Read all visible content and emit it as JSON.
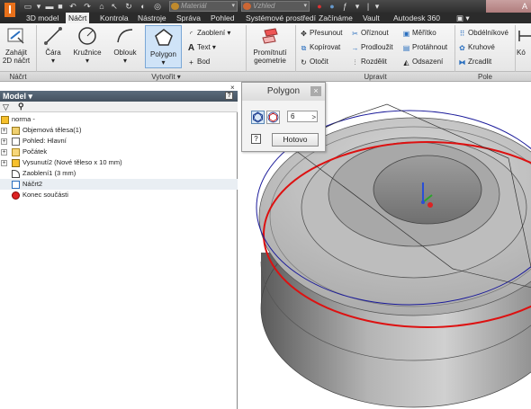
{
  "quick_access": {
    "material_placeholder": "Materiál",
    "appearance_placeholder": "Vzhled",
    "title_right": "A",
    "icons": [
      "new-file-icon",
      "open-icon",
      "save-icon",
      "undo-icon",
      "redo-icon",
      "home-icon",
      "select-icon",
      "update-icon",
      "color-swatch-icon",
      "material-icon",
      "appearance-icon",
      "formula-icon",
      "parameters-icon"
    ]
  },
  "tabs": [
    {
      "label": "3D model",
      "active": false
    },
    {
      "label": "Náčrt",
      "active": true
    },
    {
      "label": "Kontrola",
      "active": false
    },
    {
      "label": "Nástroje",
      "active": false
    },
    {
      "label": "Správa",
      "active": false
    },
    {
      "label": "Pohled",
      "active": false
    },
    {
      "label": "Systémové prostředí",
      "active": false
    },
    {
      "label": "Začínáme",
      "active": false
    },
    {
      "label": "Vault",
      "active": false
    },
    {
      "label": "Autodesk 360",
      "active": false
    },
    {
      "label": "▣ ▾",
      "active": false
    }
  ],
  "ribbon": {
    "start_sketch": {
      "line1": "Zahájit",
      "line2": "2D náčrt"
    },
    "line": "Čára",
    "circle": "Kružnice",
    "arc": "Oblouk",
    "polygon": "Polygon",
    "fillet": "Zaoblení",
    "text": "Text",
    "point": "Bod",
    "project": {
      "line1": "Promítnutí",
      "line2": "geometrie"
    },
    "move": "Přesunout",
    "copy": "Kopírovat",
    "rotate": "Otočit",
    "trim": "Oříznout",
    "extend": "Prodloužit",
    "split": "Rozdělit",
    "scale": "Měřítko",
    "stretch": "Protáhnout",
    "offset": "Odsazení",
    "rect": "Obdélníkové",
    "circular": "Kruhové",
    "mirror": "Zrcadlit",
    "cut_off": "Kó",
    "panels": {
      "sketch": "Náčrt",
      "create": "Vytvořit ▾",
      "modify": "Upravit",
      "pattern": "Pole"
    }
  },
  "browser": {
    "title": "Model ▾",
    "help": "?",
    "tree": [
      {
        "label": "norma -",
        "icon": "part-icon",
        "indent": 0,
        "expander": "",
        "hl": false
      },
      {
        "label": "Objemová tělesa(1)",
        "icon": "solid-bodies-icon",
        "indent": 1,
        "expander": "+",
        "hl": false
      },
      {
        "label": "Pohled: Hlavní",
        "icon": "view-icon",
        "indent": 1,
        "expander": "+",
        "hl": false
      },
      {
        "label": "Počátek",
        "icon": "origin-folder-icon",
        "indent": 1,
        "expander": "+",
        "hl": false
      },
      {
        "label": "Vysunutí2 (Nové těleso x 10 mm)",
        "icon": "extrude-icon",
        "indent": 1,
        "expander": "+",
        "hl": false
      },
      {
        "label": "Zaoblení1 (3 mm)",
        "icon": "fillet-feature-icon",
        "indent": 1,
        "expander": "",
        "hl": false
      },
      {
        "label": "Náčrt2",
        "icon": "sketch-icon",
        "indent": 1,
        "expander": "",
        "hl": true
      },
      {
        "label": "Konec součásti",
        "icon": "end-of-part-icon",
        "indent": 1,
        "expander": "",
        "hl": false
      }
    ]
  },
  "dialog": {
    "title": "Polygon",
    "sides_value": "6",
    "help": "?",
    "done": "Hotovo"
  },
  "colors": {
    "accent_orange": "#e8701a",
    "sketch_red": "#dd1111",
    "sketch_blue": "#1a1a9a",
    "part_gray": "#8a8a8a"
  }
}
